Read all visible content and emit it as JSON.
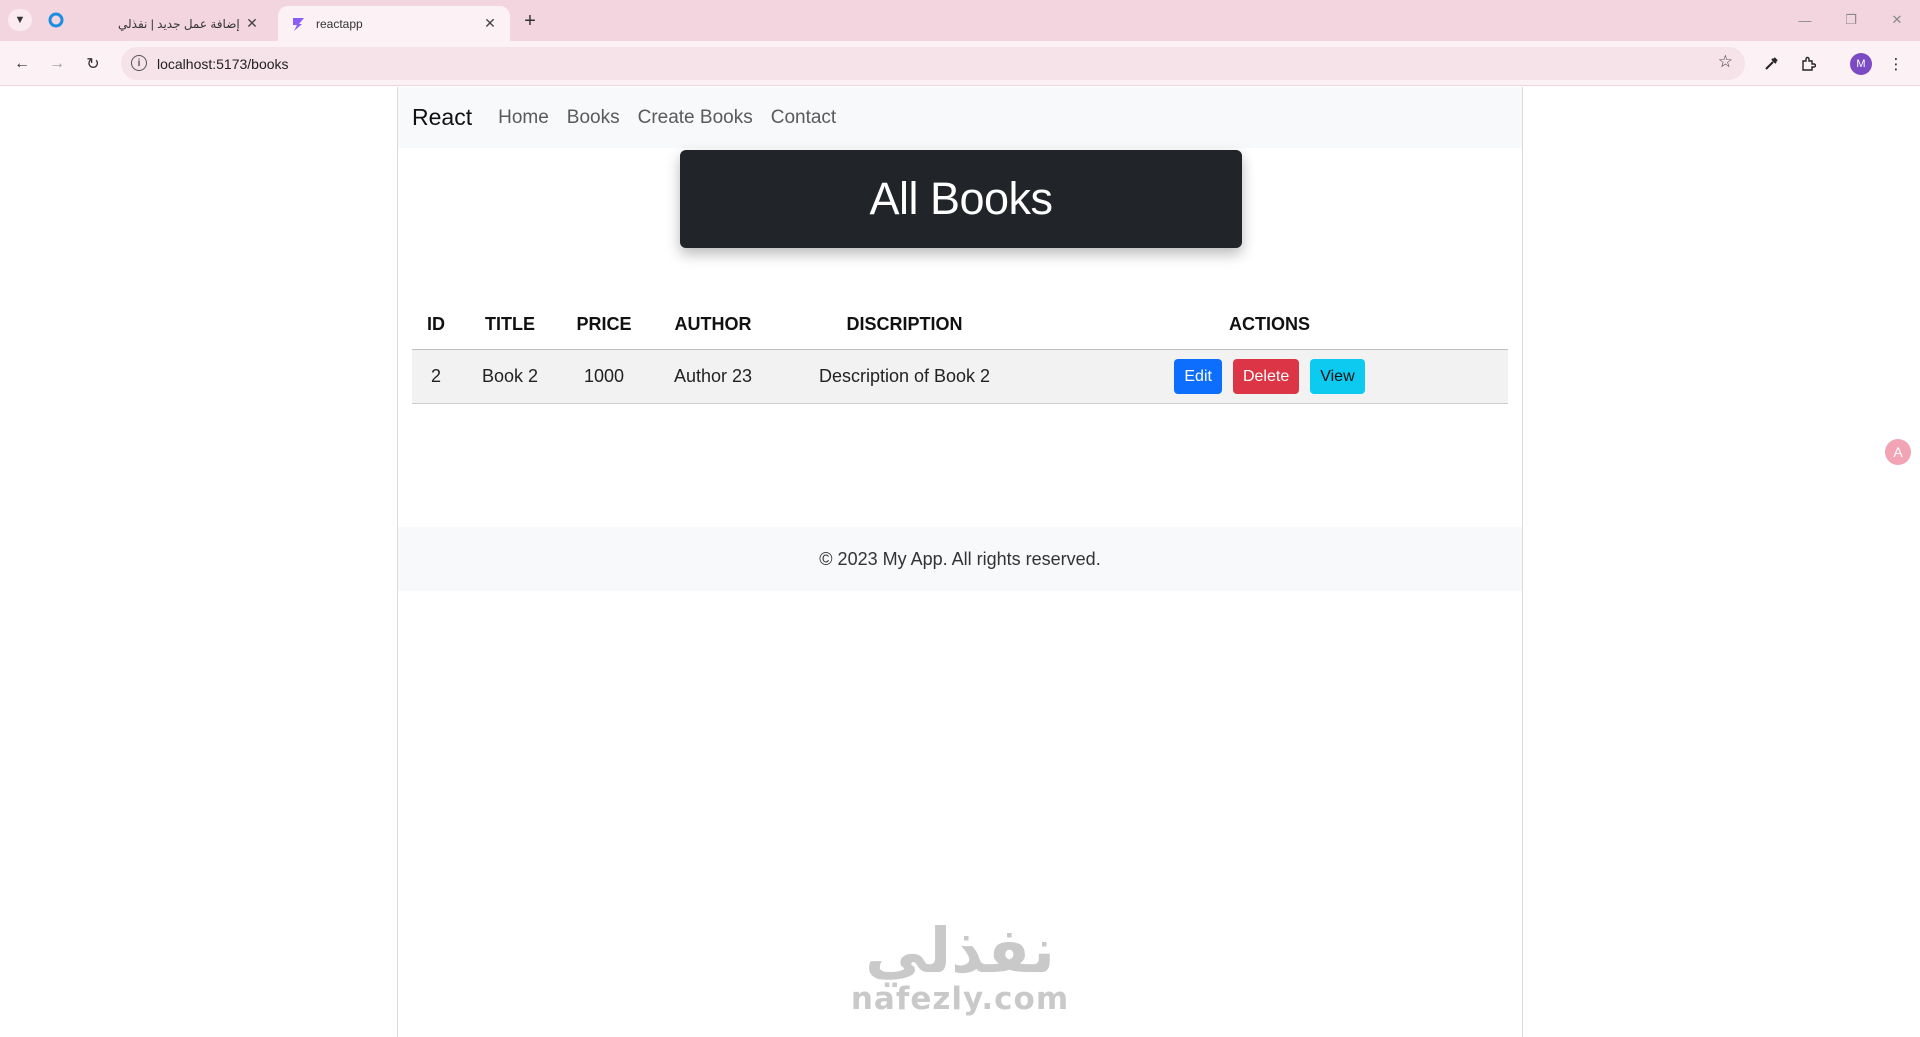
{
  "browser": {
    "tabs": [
      {
        "title": "إضافة عمل جديد | نفذلي",
        "favicon": "nafezly-icon",
        "active": false
      },
      {
        "title": "reactapp",
        "favicon": "vite-icon",
        "active": true
      }
    ],
    "url": "localhost:5173/books",
    "profile_initial": "M",
    "colors": {
      "tabbar": "#f3d5df",
      "toolbar": "#fcf1f4"
    }
  },
  "navbar": {
    "brand": "React",
    "links": [
      "Home",
      "Books",
      "Create Books",
      "Contact"
    ]
  },
  "hero": {
    "title": "All Books"
  },
  "table": {
    "headers": [
      "ID",
      "TITLE",
      "PRICE",
      "AUTHOR",
      "DISCRIPTION",
      "ACTIONS"
    ],
    "rows": [
      {
        "id": "2",
        "title": "Book 2",
        "price": "1000",
        "author": "Author 23",
        "description": "Description of Book 2"
      }
    ],
    "actions": {
      "edit": "Edit",
      "delete": "Delete",
      "view": "View"
    },
    "colors": {
      "edit": "#0d6efd",
      "delete": "#dc3545",
      "view": "#0dcaf0"
    }
  },
  "footer": {
    "text": "© 2023 My App. All rights reserved."
  },
  "watermark": {
    "arabic": "نفذلي",
    "latin": "nafezly.com"
  }
}
